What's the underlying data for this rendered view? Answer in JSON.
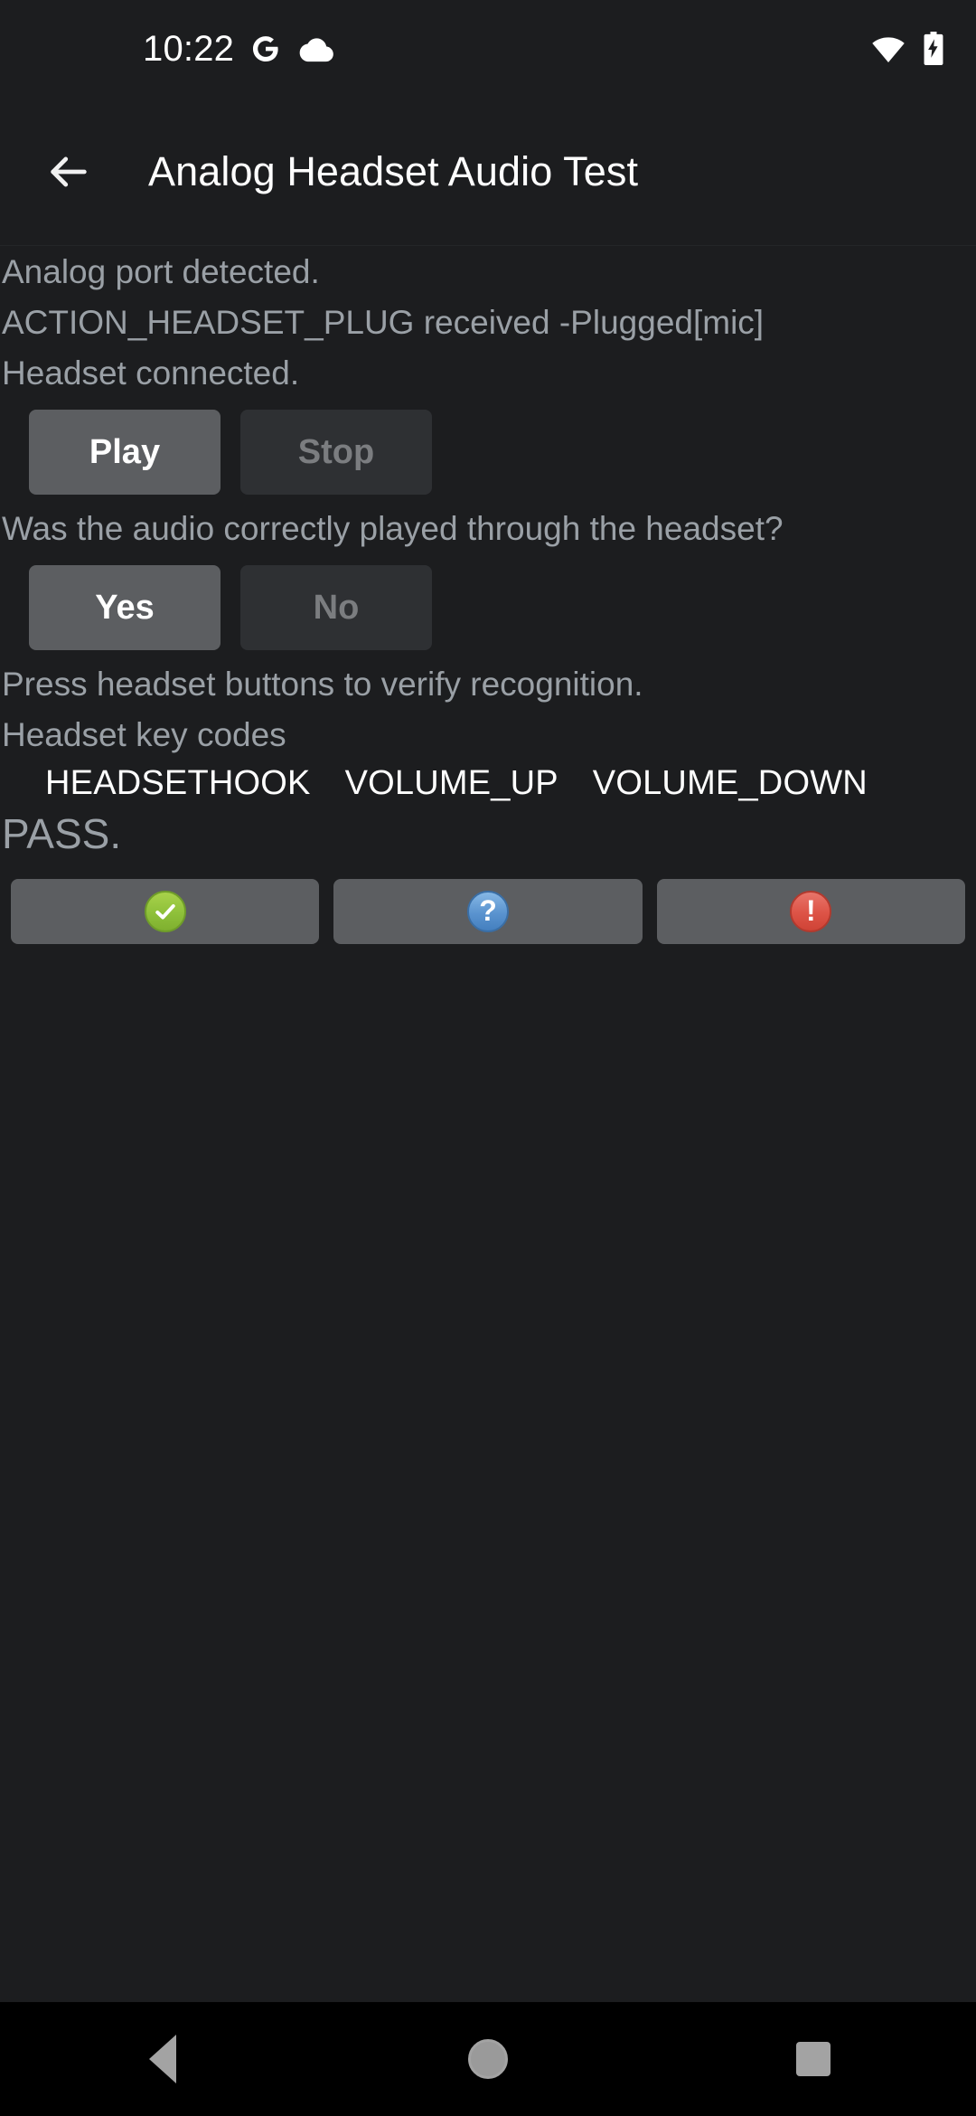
{
  "status_bar": {
    "time": "10:22",
    "left_icons": [
      "google-g-icon",
      "cloud-icon"
    ],
    "right_icons": [
      "wifi-icon",
      "battery-charging-icon"
    ]
  },
  "app_bar": {
    "back_icon": "back-arrow-icon",
    "title": "Analog Headset Audio Test"
  },
  "content": {
    "log_lines": [
      "Analog port detected.",
      "ACTION_HEADSET_PLUG received -Plugged[mic]",
      "Headset connected."
    ],
    "playback": {
      "play_label": "Play",
      "play_enabled": true,
      "stop_label": "Stop",
      "stop_enabled": false
    },
    "question": "Was the audio correctly played through the headset?",
    "answer": {
      "yes_label": "Yes",
      "yes_enabled": true,
      "no_label": "No",
      "no_enabled": false
    },
    "keys_prompt": "Press headset buttons to verify recognition.",
    "keys_heading": "Headset key codes",
    "key_codes": [
      "HEADSETHOOK",
      "VOLUME_UP",
      "VOLUME_DOWN"
    ],
    "verdict": "PASS."
  },
  "action_bar": {
    "buttons": [
      {
        "name": "pass-button",
        "icon": "check-circle-icon",
        "glyph": "✔",
        "color": "#8ec03a"
      },
      {
        "name": "info-button",
        "icon": "question-circle-icon",
        "glyph": "?",
        "color": "#5a93cf"
      },
      {
        "name": "fail-button",
        "icon": "exclamation-circle-icon",
        "glyph": "!",
        "color": "#dd5346"
      }
    ]
  },
  "nav_bar": {
    "items": [
      "back-nav-icon",
      "home-nav-icon",
      "recents-nav-icon"
    ]
  },
  "colors": {
    "background": "#1c1d1f",
    "app_bar": "#1c1d1f",
    "button_enabled": "#5c5e61",
    "button_disabled": "#2e3033",
    "text_primary": "#ffffff",
    "text_secondary": "#9aa0a6",
    "text_disabled": "#7b7d80",
    "nav_bar": "#000000"
  }
}
